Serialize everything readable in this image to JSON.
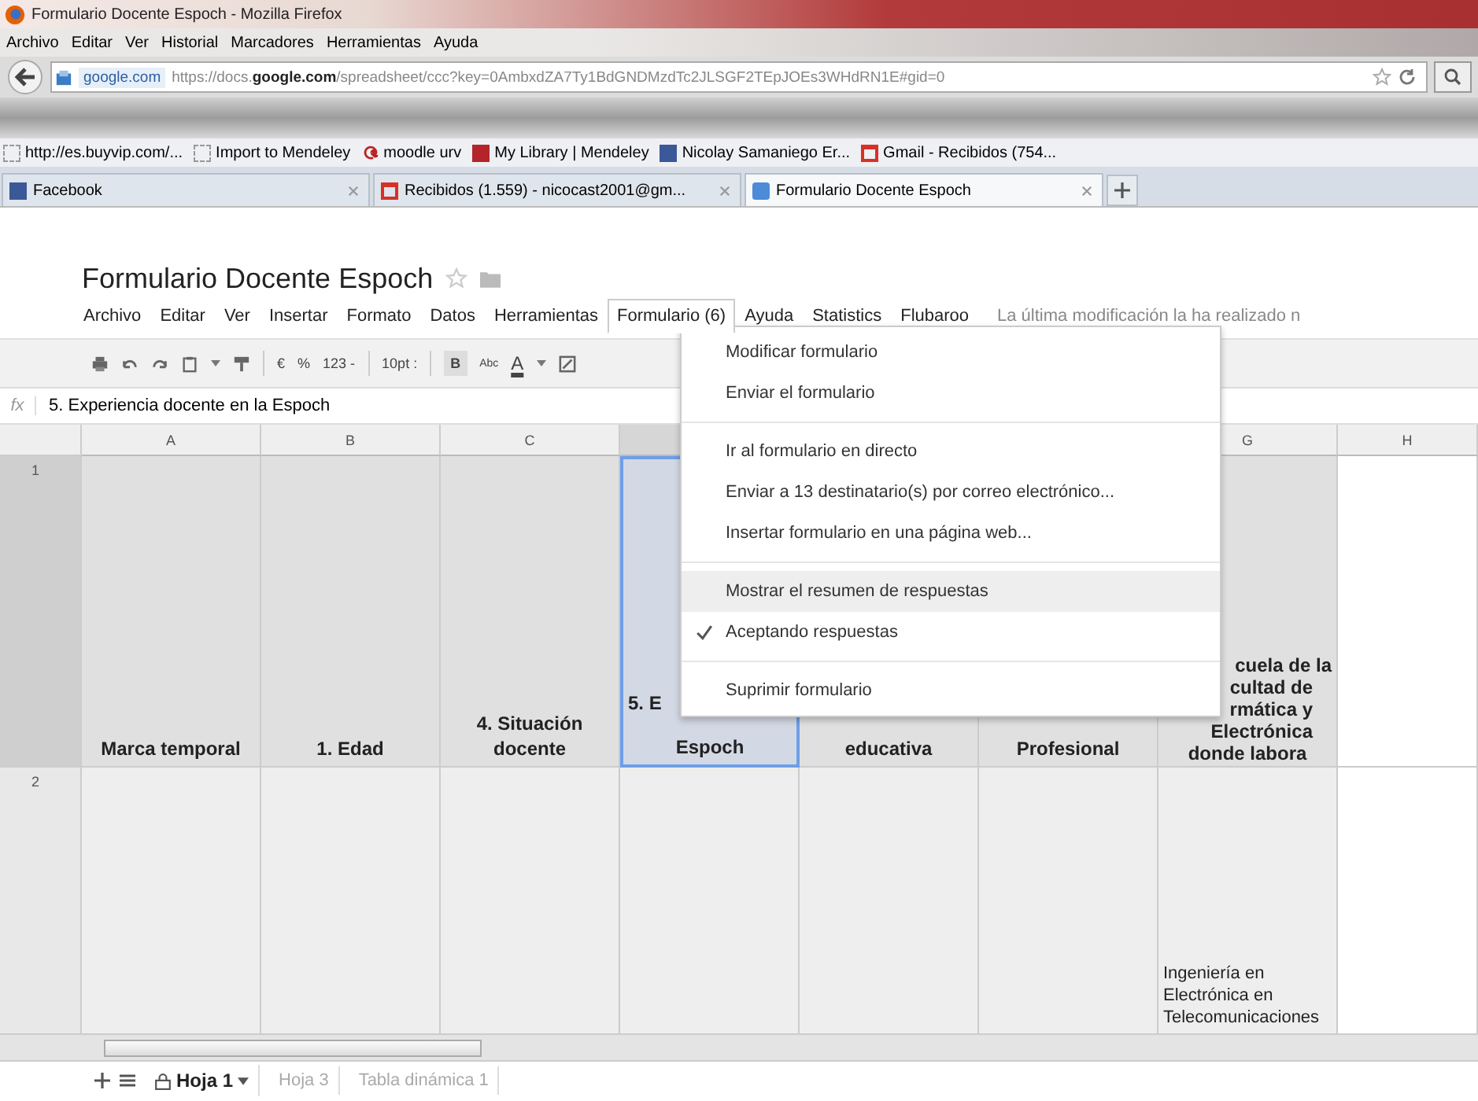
{
  "window": {
    "title": "Formulario Docente Espoch - Mozilla Firefox"
  },
  "browser_menu": [
    "Archivo",
    "Editar",
    "Ver",
    "Historial",
    "Marcadores",
    "Herramientas",
    "Ayuda"
  ],
  "address_bar": {
    "site": "google.com",
    "url": "https://docs.**google.com**/spreadsheet/ccc?key=0AmbxdZA7Ty1BdGNDMzdTc2JLSGF2TEpJOEs3WHdRN1E#gid=0"
  },
  "bookmarks": [
    {
      "label": "http://es.buyvip.com/...",
      "kind": "page"
    },
    {
      "label": "Import to Mendeley",
      "kind": "page"
    },
    {
      "label": "moodle urv",
      "kind": "moodle"
    },
    {
      "label": "My Library | Mendeley",
      "kind": "mendeley"
    },
    {
      "label": "Nicolay Samaniego Er...",
      "kind": "facebook"
    },
    {
      "label": "Gmail - Recibidos (754...",
      "kind": "gmail"
    }
  ],
  "browser_tabs": [
    {
      "label": "Facebook",
      "kind": "facebook",
      "selected": false
    },
    {
      "label": "Recibidos (1.559) - nicocast2001@gm...",
      "kind": "gmail",
      "selected": false
    },
    {
      "label": "Formulario Docente Espoch",
      "kind": "docs",
      "selected": true
    }
  ],
  "document": {
    "title": "Formulario Docente Espoch",
    "starred": false
  },
  "doc_menu": [
    {
      "label": "Archivo",
      "selected": false
    },
    {
      "label": "Editar",
      "selected": false
    },
    {
      "label": "Ver",
      "selected": false
    },
    {
      "label": "Insertar",
      "selected": false
    },
    {
      "label": "Formato",
      "selected": false
    },
    {
      "label": "Datos",
      "selected": false
    },
    {
      "label": "Herramientas",
      "selected": false
    },
    {
      "label": "Formulario (6)",
      "selected": true
    },
    {
      "label": "Ayuda",
      "selected": false
    },
    {
      "label": "Statistics",
      "selected": false
    },
    {
      "label": "Flubaroo",
      "selected": false
    }
  ],
  "last_edit": "La última modificación la ha realizado n",
  "toolbar": {
    "currency": "€",
    "percent": "%",
    "number_format": "123 -",
    "font_size": "10pt :",
    "bold": "B",
    "strike": "Abc",
    "text_color": "A"
  },
  "formula_bar": {
    "label": "fx",
    "value": "5. Experiencia docente en la Espoch"
  },
  "columns": [
    "A",
    "B",
    "C",
    "G",
    "H"
  ],
  "rows": [
    {
      "number": "1",
      "cells": [
        {
          "lines": [
            "Marca temporal"
          ],
          "selected": false
        },
        {
          "lines": [
            "1. Edad"
          ],
          "selected": false
        },
        {
          "lines": [
            "4. Situación",
            "docente"
          ],
          "selected": false
        },
        {
          "lines": [
            "5. E",
            "Espoch"
          ],
          "selected": true
        },
        {
          "lines": [
            "educativa"
          ],
          "selected": false
        },
        {
          "lines": [
            "Profesional"
          ],
          "selected": false
        },
        {
          "lines": [
            "cuela de la",
            "cultad de",
            "rmática y",
            "Electrónica",
            "donde labora"
          ],
          "selected": false
        },
        {
          "selected": false
        }
      ]
    },
    {
      "number": "2",
      "cells": [
        {
          "selected": false
        },
        {
          "selected": false
        },
        {
          "selected": false
        },
        {
          "selected": false
        },
        {
          "selected": false
        },
        {
          "selected": false
        },
        {
          "lines": [
            "Ingeniería en",
            "Electrónica en",
            "Telecomunicaciones"
          ],
          "selected": false
        },
        {
          "selected": false
        }
      ]
    }
  ],
  "dropdown_menu": [
    [
      {
        "label": "Modificar formulario",
        "checked": false,
        "highlighted": false
      },
      {
        "label": "Enviar el formulario",
        "checked": false,
        "highlighted": false
      }
    ],
    [
      {
        "label": "Ir al formulario en directo",
        "checked": false,
        "highlighted": false
      },
      {
        "label": "Enviar a 13 destinatario(s) por correo electrónico...",
        "checked": false,
        "highlighted": false
      },
      {
        "label": "Insertar formulario en una página web...",
        "checked": false,
        "highlighted": false
      }
    ],
    [
      {
        "label": "Mostrar el resumen de respuestas",
        "checked": false,
        "highlighted": true
      },
      {
        "label": "Aceptando respuestas",
        "checked": true,
        "highlighted": false
      }
    ],
    [
      {
        "label": "Suprimir formulario",
        "checked": false,
        "highlighted": false
      }
    ]
  ],
  "sheet_tabs": [
    {
      "label": "Hoja 1",
      "locked": true,
      "selected": true
    },
    {
      "label": "Hoja 3",
      "locked": false,
      "selected": false
    },
    {
      "label": "Tabla dinámica 1",
      "locked": false,
      "selected": false
    }
  ]
}
